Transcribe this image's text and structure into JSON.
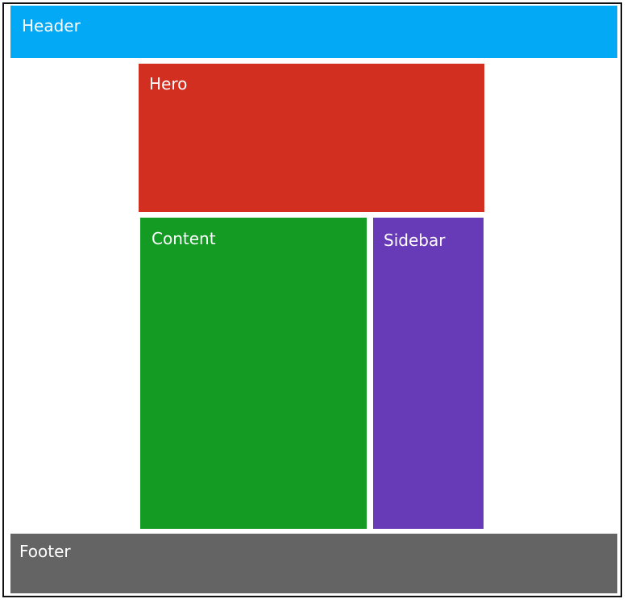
{
  "regions": {
    "header": {
      "label": "Header",
      "color": "#03a9f4"
    },
    "hero": {
      "label": "Hero",
      "color": "#d32f20"
    },
    "content": {
      "label": "Content",
      "color": "#149b24"
    },
    "sidebar": {
      "label": "Sidebar",
      "color": "#673ab7"
    },
    "footer": {
      "label": "Footer",
      "color": "#646464"
    }
  }
}
